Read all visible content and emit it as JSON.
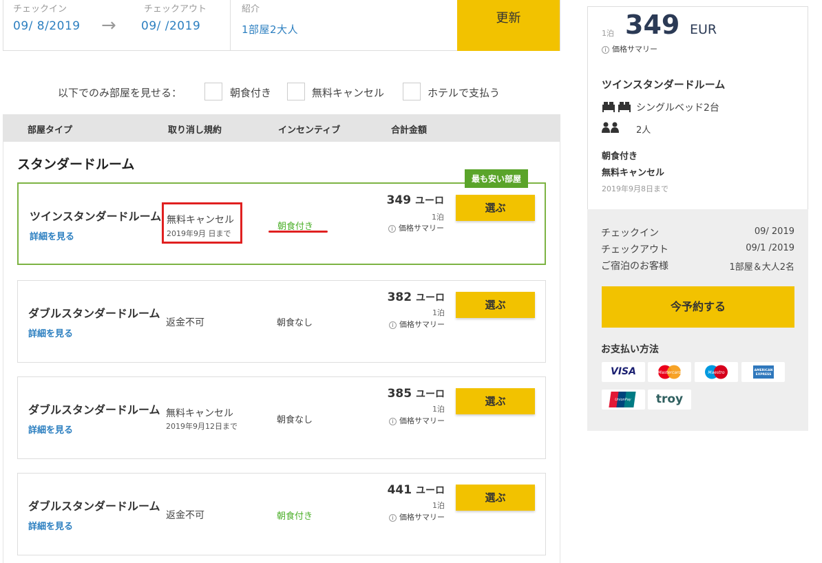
{
  "search": {
    "checkin_label": "チェックイン",
    "checkin_value": "09/  8/2019",
    "checkout_label": "チェックアウト",
    "checkout_value": "09/    /2019",
    "guests_label": "紹介",
    "guests_value": "1部屋2大人",
    "update_label": "更新"
  },
  "filter": {
    "label": "以下でのみ部屋を見せる：",
    "options": [
      "朝食付き",
      "無料キャンセル",
      "ホテルで支払う"
    ]
  },
  "table": {
    "headers": [
      "部屋タイプ",
      "取り消し規約",
      "インセンティブ",
      "合計金額"
    ],
    "section_title": "スタンダードルーム",
    "cheapest_badge": "最も安い部屋",
    "rows": [
      {
        "name": "ツインスタンダードルーム",
        "link": "詳細を見る",
        "policy": "無料キャンセル",
        "policy_sub": "2019年9月  日まで",
        "incentive": "朝食付き",
        "price": "349",
        "unit": "ユーロ",
        "nights": "1泊",
        "summary": "価格サマリー",
        "select": "選ぶ"
      },
      {
        "name": "ダブルスタンダードルーム",
        "link": "詳細を見る",
        "policy": "返金不可",
        "policy_sub": "",
        "incentive": "朝食なし",
        "price": "382",
        "unit": "ユーロ",
        "nights": "1泊",
        "summary": "価格サマリー",
        "select": "選ぶ"
      },
      {
        "name": "ダブルスタンダードルーム",
        "link": "詳細を見る",
        "policy": "無料キャンセル",
        "policy_sub": "2019年9月12日まで",
        "incentive": "朝食なし",
        "price": "385",
        "unit": "ユーロ",
        "nights": "1泊",
        "summary": "価格サマリー",
        "select": "選ぶ"
      },
      {
        "name": "ダブルスタンダードルーム",
        "link": "詳細を見る",
        "policy": "返金不可",
        "policy_sub": "",
        "incentive": "朝食付き",
        "price": "441",
        "unit": "ユーロ",
        "nights": "1泊",
        "summary": "価格サマリー",
        "select": "選ぶ"
      }
    ]
  },
  "summary": {
    "nights": "1泊",
    "price": "349",
    "currency": "EUR",
    "price_summary": "価格サマリー",
    "room_name": "ツインスタンダードルーム",
    "beds": "シングルベッド2台",
    "guests": "2人",
    "breakfast": "朝食付き",
    "cancel": "無料キャンセル",
    "cancel_until": "2019年9月8日まで",
    "checkin_label": "チェックイン",
    "checkin_value": "09/   2019",
    "checkout_label": "チェックアウト",
    "checkout_value": "09/1 /2019",
    "guests_label": "ご宿泊のお客様",
    "guests_value": "1部屋＆大人2名",
    "book_label": "今予約する",
    "payment_title": "お支払い方法",
    "payment_cards": [
      "VISA",
      "Mastercard",
      "Maestro",
      "AMERICAN EXPRESS",
      "UnionPay",
      "troy"
    ]
  },
  "colors": {
    "accent_yellow": "#f2c200",
    "link_blue": "#2c7fc0",
    "green": "#5aa42a",
    "highlight_red": "#e02020"
  }
}
